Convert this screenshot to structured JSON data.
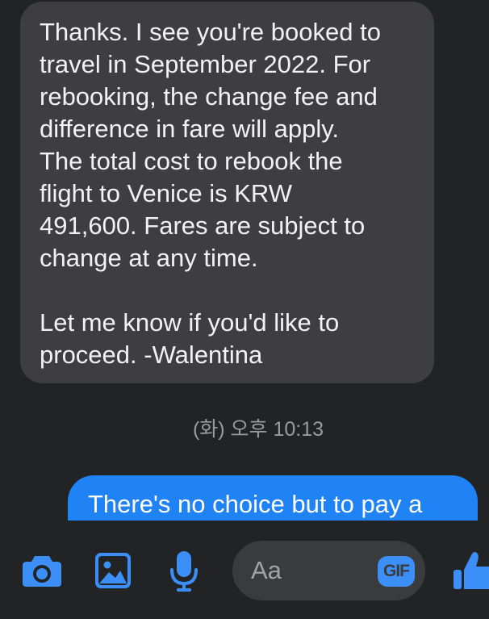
{
  "conversation": {
    "incoming_message": {
      "lines": [
        "Thanks. I see you're booked to",
        "travel in September 2022. For",
        "rebooking, the change fee and",
        "difference in fare will apply.",
        "The total cost to rebook the",
        "flight to Venice is KRW",
        "491,600. Fares are subject to",
        "change at any time.",
        "",
        "Let me know if you'd like to",
        "proceed. -Walentina"
      ]
    },
    "timestamp": "(화) 오후 10:13",
    "outgoing_message": {
      "first_visible_line": "There's no choice but to pay a"
    }
  },
  "composer": {
    "input_placeholder": "Aa",
    "gif_label": "GIF",
    "icons": [
      "camera-icon",
      "photo-icon",
      "microphone-icon",
      "thumbs-up-icon"
    ]
  },
  "colors": {
    "background": "#222325",
    "incoming_bubble": "#3e3e40",
    "outgoing_bubble": "#1f82f5",
    "accent": "#3b8ff6"
  }
}
